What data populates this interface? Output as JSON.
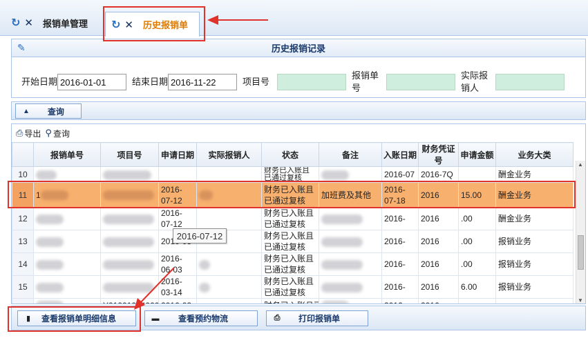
{
  "tabs": [
    {
      "label": "报销单管理",
      "active": false
    },
    {
      "label": "历史报销单",
      "active": true
    }
  ],
  "panel": {
    "title": "历史报销记录"
  },
  "form": {
    "start_date_label": "开始日期",
    "start_date_value": "2016-01-01",
    "end_date_label": "结束日期",
    "end_date_value": "2016-11-22",
    "project_label": "项目号",
    "project_value": "",
    "receipt_label": "报销单号",
    "receipt_value": "",
    "actual_label": "实际报销人",
    "actual_value": ""
  },
  "query_bar": {
    "label": "查询"
  },
  "toolbar": {
    "export_label": "导出",
    "search_label": "查询"
  },
  "table": {
    "columns": [
      "",
      "报销单号",
      "项目号",
      "申请日期",
      "实际报销人",
      "状态",
      "备注",
      "入账日期",
      "财务凭证号",
      "申请金额",
      "业务大类"
    ],
    "rows": [
      {
        "rn": "10",
        "date": "",
        "status": "财务已入账且已通过复核",
        "note": "",
        "entry_date": "2016-07",
        "voucher": "2016-7Q",
        "amount": "",
        "category": "酬金业务",
        "partial": "top"
      },
      {
        "rn": "11",
        "date": "2016-07-12",
        "status": "财务已入账且已通过复核",
        "note": "加班费及其他",
        "entry_date": "2016-07-18",
        "voucher": "2016",
        "amount": "15.00",
        "category": "酬金业务",
        "partial": ""
      },
      {
        "rn": "12",
        "date": "2016-07-12",
        "status": "财务已入账且已通过复核",
        "note": "",
        "entry_date": "2016-",
        "voucher": "2016",
        "amount": ".00",
        "category": "酬金业务",
        "partial": ""
      },
      {
        "rn": "13",
        "date": "2016-03",
        "status": "财务已入账且已通过复核",
        "note": "",
        "entry_date": "2016-",
        "voucher": "2016",
        "amount": ".00",
        "category": "报销业务",
        "partial": ""
      },
      {
        "rn": "14",
        "date": "2016-06-03",
        "status": "财务已入账且已通过复核",
        "note": "",
        "entry_date": "2016-",
        "voucher": "2016",
        "amount": ".00",
        "category": "报销业务",
        "partial": ""
      },
      {
        "rn": "15",
        "date": "2016-03-14",
        "status": "财务已入账且已通过复核",
        "note": "",
        "entry_date": "2016-",
        "voucher": "2016",
        "amount": "6.00",
        "category": "报销业务",
        "partial": ""
      },
      {
        "rn": "",
        "date": "2016-02-",
        "status": "财务已入账且已",
        "note": "",
        "entry_date": "2016",
        "voucher": "2016",
        "amount": "",
        "category": "",
        "project": "Y0100102400010",
        "partial": "bottom"
      }
    ]
  },
  "tooltip": {
    "text": "2016-07-12"
  },
  "buttons": {
    "detail": "查看报销单明细信息",
    "logistics": "查看预约物流",
    "print": "打印报销单"
  },
  "colors": {
    "selected_row": "#f8b06e",
    "highlight_box": "#e0312b",
    "active_tab_text": "#e07b00",
    "accent_blue": "#2a6ec2"
  }
}
